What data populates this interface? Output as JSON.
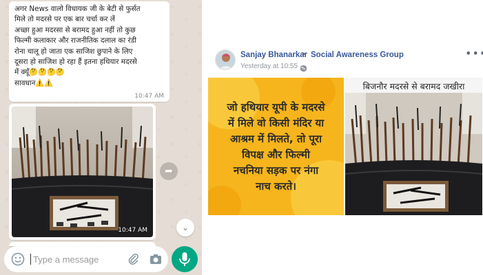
{
  "whatsapp": {
    "message1": {
      "text": "अगर News वालो विधायक जी के बेटी से फुर्सत\nमिले तो मदरसे पर एक बार चर्चा कर लें\nअच्छा हुआ मदरसा से बरामद हुआ नहीं तो कुछ\nफिल्मी कलाकार और राजनीतिक दलाल का रंडी\nरोना चालू हो जाता एक साजिश छुपाने के लिए\nदूसरा हो साजिश हो रहा हैं इतना हथियार मदरसे\nमें क्यूँ🤔🤔🤔🤔\nसावधान⚠️⚠️",
      "time": "10:47 AM"
    },
    "message2": {
      "time": "10:47 AM"
    },
    "composer": {
      "placeholder": "Type a message"
    },
    "colors": {
      "accent": "#00a884",
      "bubble": "#ffffff",
      "background": "#e5ddd5"
    }
  },
  "facebook": {
    "author": "Sanjay Bhanarkar",
    "separator": "▸",
    "group": "Social Awareness Group",
    "timestamp": "Yesterday at 10:55 ·",
    "more": "•••",
    "poster_text": "जो हथियार यूपी के मदरसे\nमें मिले वो किसी मंदिर या\nआश्रम में मिलते, तो पूरा\nविपक्ष और फिल्मी\nनचनिया सड़क पर नंगा\nनाच करते।",
    "photo_caption": "बिजनौर मदरसे से बरामद जखीरा",
    "colors": {
      "link": "#385898",
      "poster_bg": "#f6b51d"
    }
  }
}
